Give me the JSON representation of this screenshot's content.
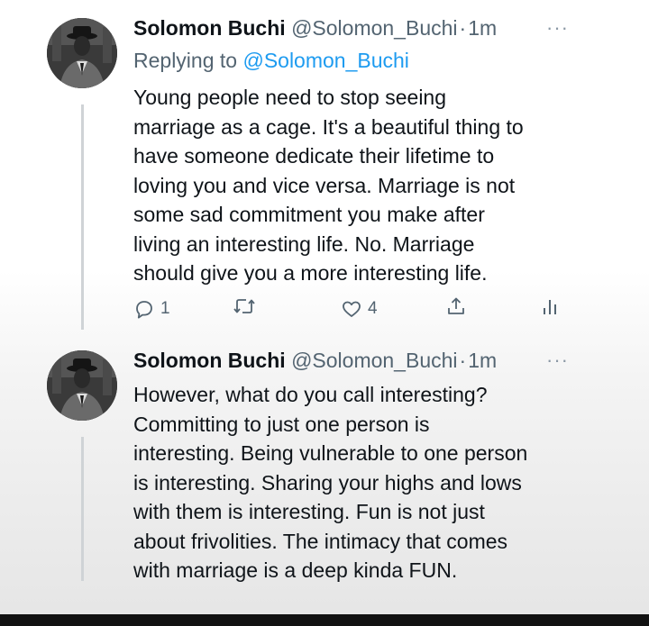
{
  "tweets": [
    {
      "author_name": "Solomon Buchi",
      "handle": "@Solomon_Buchi",
      "separator": "·",
      "time": "1m",
      "more": "···",
      "replying_prefix": "Replying to",
      "replying_handle": "@Solomon_Buchi",
      "lines": [
        "Young people need to stop seeing",
        "marriage as a cage. It's a beautiful thing to",
        "have someone dedicate their lifetime to",
        "loving you and vice versa. Marriage is not",
        "some sad commitment you make after",
        "living an interesting life. No. Marriage",
        "should give you a more interesting life."
      ],
      "actions": {
        "reply_count": "1",
        "retweet_count": "",
        "like_count": "4"
      }
    },
    {
      "author_name": "Solomon Buchi",
      "handle": "@Solomon_Buchi",
      "separator": "·",
      "time": "1m",
      "more": "···",
      "lines": [
        "However, what do you call interesting?",
        "Committing to just one person is",
        "interesting. Being vulnerable to one person",
        "is interesting. Sharing your highs and lows",
        "with them is interesting. Fun is not just",
        "about frivolities. The intimacy that comes",
        "with marriage is a deep kinda FUN."
      ]
    }
  ],
  "icons": {
    "reply": "reply-icon",
    "retweet": "retweet-icon",
    "like": "heart-icon",
    "share": "share-icon",
    "analytics": "analytics-icon",
    "more": "more-icon"
  },
  "colors": {
    "name": "#0f1419",
    "secondary": "#536471",
    "link": "#1d9bf0",
    "thread_line": "#cfd3d6"
  }
}
